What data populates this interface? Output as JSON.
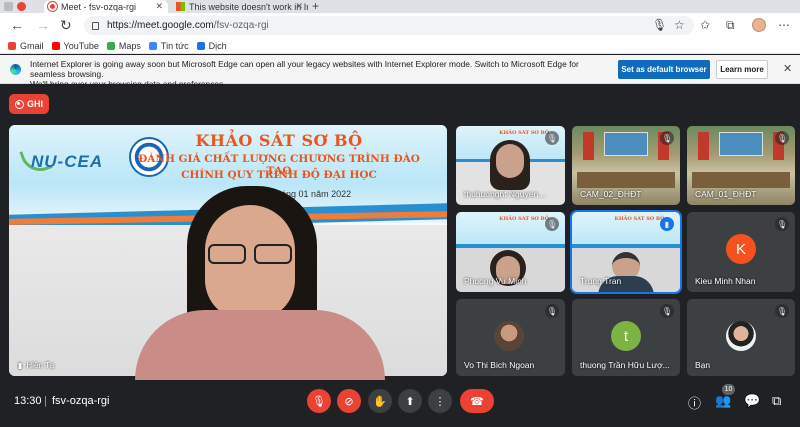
{
  "browser": {
    "tabs": [
      {
        "title": "Meet - fsv-ozqa-rgi"
      },
      {
        "title": "This website doesn't work in Inte"
      }
    ],
    "url_host": "https://meet.google.com",
    "url_path": "/fsv-ozqa-rgi",
    "bookmarks": [
      "Gmail",
      "YouTube",
      "Maps",
      "Tin tức",
      "Dịch"
    ]
  },
  "ie_banner": {
    "line1": "Internet Explorer is going away soon but Microsoft Edge can open all your legacy websites with Internet Explorer mode. Switch to Microsoft Edge for seamless browsing.",
    "line2": "We'll bring over your browsing data and preferences.",
    "primary_label": "Set as default browser",
    "secondary_label": "Learn more"
  },
  "meeting": {
    "record_label": "GHI",
    "slide": {
      "line1": "KHẢO SÁT SƠ BỘ",
      "line2": "ĐÁNH GIÁ CHẤT LƯỢNG CHƯƠNG TRÌNH ĐÀO TẠO",
      "line3": "CHÍNH QUY TRÌNH ĐỘ ĐẠI HỌC",
      "date": "ngày 05 tháng 01 năm 2022",
      "logo": "NU-CEA"
    },
    "main_name": "Hiền Tạ",
    "participants": [
      {
        "name": "thuhuongnt Nguyen..."
      },
      {
        "name": "CAM_02_ĐHĐT"
      },
      {
        "name": "CAM_01_ĐHĐT"
      },
      {
        "name": "Phuong Vu Minh"
      },
      {
        "name": "Trung Tran"
      },
      {
        "name": "Kieu Minh Nhan",
        "initial": "K",
        "color": "#f4511e"
      },
      {
        "name": "Vo Thi Bich Ngoan"
      },
      {
        "name": "thuong Trần Hữu Lượ...",
        "initial": "t",
        "color": "#7cb342"
      },
      {
        "name": "Bạn"
      }
    ],
    "time": "13:30",
    "code": "fsv-ozqa-rgi",
    "participant_count": "10"
  }
}
